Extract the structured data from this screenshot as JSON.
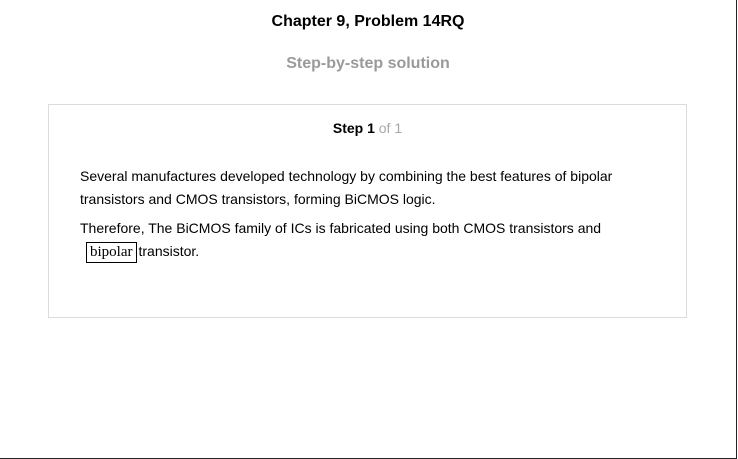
{
  "header": {
    "title": "Chapter 9, Problem 14RQ",
    "subtitle": "Step-by-step solution"
  },
  "step": {
    "label": "Step 1",
    "of_text": "of 1"
  },
  "content": {
    "paragraph1": "Several manufactures developed technology by combining the best features of bipolar transistors and CMOS transistors, forming BiCMOS logic.",
    "paragraph2": "Therefore, The BiCMOS family of ICs is fabricated using both CMOS transistors and",
    "answer": "bipolar",
    "after_answer": "transistor."
  }
}
